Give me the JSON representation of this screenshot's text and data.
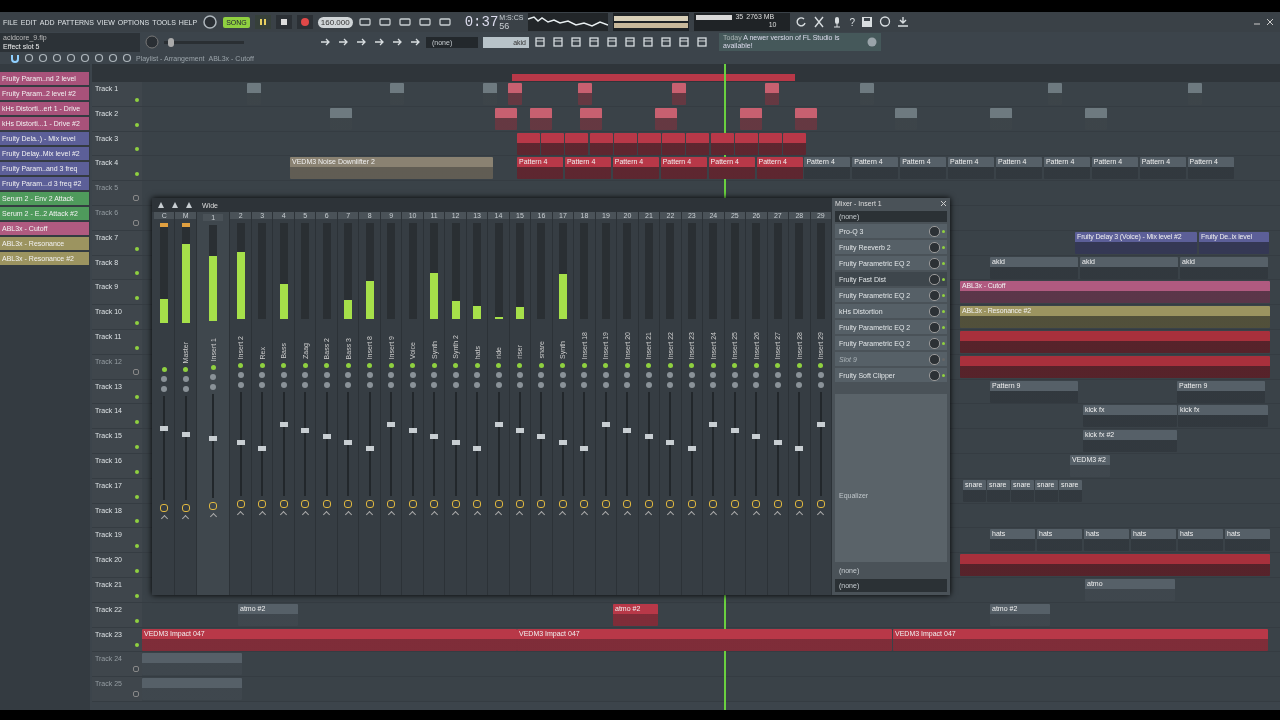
{
  "menu": [
    "FILE",
    "EDIT",
    "ADD",
    "PATTERNS",
    "VIEW",
    "OPTIONS",
    "TOOLS",
    "HELP"
  ],
  "transport": {
    "mode": "SONG",
    "song_mode": true,
    "playing": true,
    "tempo": "160.000",
    "time": "0:37",
    "time_small": "56",
    "time_unit": "M:S:CS",
    "cpu": "35",
    "memory": "2763 MB",
    "polyphony": "10",
    "help": "?"
  },
  "project": {
    "file": "acidcore_9.flp",
    "hint": "Effect slot 5"
  },
  "toolbar": {
    "pitch": {
      "level": 0.05
    },
    "pattern": "(none)",
    "channel": "akid",
    "news_day": "Today",
    "news": "A newer version of FL Studio is available!"
  },
  "breadcrumb": {
    "window": "Playlist - Arrangement",
    "target": "ABL3x - Cutoff"
  },
  "clip_list": [
    {
      "label": "Fruity Param..nd 2 level",
      "color": "#a8527a"
    },
    {
      "label": "Fruity Param..2 level #2",
      "color": "#a8527a"
    },
    {
      "label": "kHs Distorti...ert 1 - Drive",
      "color": "#a8527a"
    },
    {
      "label": "kHs Distorti...1 - Drive #2",
      "color": "#a8527a"
    },
    {
      "label": "Fruity Dela..) - Mix level",
      "color": "#5c5f98"
    },
    {
      "label": "Fruity Delay..Mix level #2",
      "color": "#5c5f98"
    },
    {
      "label": "Fruity Param..and 3 freq",
      "color": "#5c5f98"
    },
    {
      "label": "Fruity Param...d 3 freq #2",
      "color": "#5c5f98"
    },
    {
      "label": "Serum 2 - Env 2 Attack",
      "color": "#4f9a5c"
    },
    {
      "label": "Serum 2 - E..2 Attack #2",
      "color": "#4f9a5c"
    },
    {
      "label": "ABL3x - Cutoff",
      "color": "#b05a80"
    },
    {
      "label": "ABL3x - Resonance",
      "color": "#9c9460"
    },
    {
      "label": "ABL3x - Resonance #2",
      "color": "#9c9460"
    }
  ],
  "tracks": [
    {
      "name": "Track 1",
      "muted": false,
      "clips": [
        {
          "kind": "automation",
          "color": "#6e7a80"
        },
        {
          "kind": "automation",
          "color": "#6e7a80"
        },
        {
          "kind": "automation",
          "color": "#6e7a80"
        },
        {
          "kind": "automation",
          "color": "#c86070"
        },
        {
          "kind": "automation",
          "color": "#c86070"
        },
        {
          "kind": "automation",
          "color": "#c86070"
        },
        {
          "kind": "automation",
          "color": "#c86070"
        },
        {
          "kind": "automation",
          "color": "#6e7a80"
        },
        {
          "kind": "automation",
          "color": "#6e7a80"
        },
        {
          "kind": "automation",
          "color": "#6e7a80"
        }
      ]
    },
    {
      "name": "Track 2",
      "muted": false,
      "clips": [
        {
          "kind": "automation",
          "color": "#6e7a80"
        },
        {
          "kind": "automation",
          "color": "#c86070"
        },
        {
          "kind": "automation",
          "color": "#c86070"
        },
        {
          "kind": "automation",
          "color": "#c86070"
        },
        {
          "kind": "automation",
          "color": "#c86070"
        },
        {
          "kind": "automation",
          "color": "#c86070"
        },
        {
          "kind": "automation",
          "color": "#c86070"
        },
        {
          "kind": "automation",
          "color": "#6e7a80"
        },
        {
          "kind": "automation",
          "color": "#6e7a80"
        },
        {
          "kind": "automation",
          "color": "#6e7a80"
        }
      ]
    },
    {
      "name": "Track 3",
      "muted": false,
      "clips": [
        {
          "kind": "pattern",
          "color": "#b83848"
        },
        {
          "kind": "pattern",
          "color": "#b83848"
        },
        {
          "kind": "pattern",
          "color": "#b83848"
        },
        {
          "kind": "pattern",
          "color": "#b83848"
        },
        {
          "kind": "pattern",
          "color": "#b83848"
        },
        {
          "kind": "pattern",
          "color": "#b83848"
        },
        {
          "kind": "pattern",
          "color": "#b83848"
        },
        {
          "kind": "pattern",
          "color": "#b83848"
        },
        {
          "kind": "pattern",
          "color": "#b83848"
        },
        {
          "kind": "pattern",
          "color": "#b83848"
        },
        {
          "kind": "pattern",
          "color": "#b83848"
        },
        {
          "kind": "pattern",
          "color": "#b83848"
        }
      ]
    },
    {
      "name": "Track 4",
      "muted": false,
      "clips": [
        {
          "kind": "audio",
          "label": "VEDM3 Noise Downlifter 2",
          "color": "#8a8272"
        },
        {
          "kind": "pattern",
          "label": "Pattern 4",
          "color": "#b83848"
        },
        {
          "kind": "pattern",
          "label": "Pattern 4",
          "color": "#b83848"
        },
        {
          "kind": "pattern",
          "label": "Pattern 4",
          "color": "#b83848"
        },
        {
          "kind": "pattern",
          "label": "Pattern 4",
          "color": "#b83848"
        },
        {
          "kind": "pattern",
          "label": "Pattern 4",
          "color": "#b83848"
        },
        {
          "kind": "pattern",
          "label": "Pattern 4",
          "color": "#b83848"
        },
        {
          "kind": "pattern",
          "label": "Pattern 4",
          "color": "#566068"
        },
        {
          "kind": "pattern",
          "label": "Pattern 4",
          "color": "#566068"
        },
        {
          "kind": "pattern",
          "label": "Pattern 4",
          "color": "#566068"
        },
        {
          "kind": "pattern",
          "label": "Pattern 4",
          "color": "#566068"
        },
        {
          "kind": "pattern",
          "label": "Pattern 4",
          "color": "#566068"
        },
        {
          "kind": "pattern",
          "label": "Pattern 4",
          "color": "#566068"
        },
        {
          "kind": "pattern",
          "label": "Pattern 4",
          "color": "#566068"
        },
        {
          "kind": "pattern",
          "label": "Pattern 4",
          "color": "#566068"
        },
        {
          "kind": "pattern",
          "label": "Pattern 4",
          "color": "#566068"
        }
      ]
    },
    {
      "name": "Track 5",
      "muted": true
    },
    {
      "name": "Track 6",
      "muted": true
    },
    {
      "name": "Track 7",
      "muted": false,
      "clips": [
        {
          "kind": "automation",
          "label": "Fruity Delay 3 (Voice) - Mix level #2",
          "color": "#5c5f98"
        },
        {
          "kind": "automation",
          "label": "Fruity De..ix level",
          "color": "#5c5f98"
        }
      ]
    },
    {
      "name": "Track 8",
      "muted": false,
      "clips": [
        {
          "kind": "pattern",
          "label": "akid",
          "color": "#566068"
        },
        {
          "kind": "pattern",
          "label": "akid",
          "color": "#566068"
        },
        {
          "kind": "pattern",
          "label": "akid",
          "color": "#566068"
        }
      ]
    },
    {
      "name": "Track 9",
      "muted": false,
      "clips": [
        {
          "kind": "automation",
          "label": "ABL3x - Cutoff",
          "color": "#b05a80"
        }
      ]
    },
    {
      "name": "Track 10",
      "muted": false,
      "clips": [
        {
          "kind": "automation",
          "label": "ABL3x - Resonance #2",
          "color": "#9c9460"
        }
      ]
    },
    {
      "name": "Track 11",
      "muted": false,
      "clips": [
        {
          "kind": "pattern",
          "color": "#a8303c"
        }
      ]
    },
    {
      "name": "Track 12",
      "muted": true,
      "clips": [
        {
          "kind": "pattern",
          "color": "#a8303c"
        }
      ]
    },
    {
      "name": "Track 13",
      "muted": false,
      "clips": [
        {
          "kind": "pattern",
          "label": "Pattern 9",
          "color": "#566068"
        },
        {
          "kind": "pattern",
          "label": "Pattern 9",
          "color": "#566068"
        }
      ]
    },
    {
      "name": "Track 14",
      "muted": false,
      "clips": [
        {
          "kind": "pattern",
          "label": "kick fx",
          "color": "#566068"
        },
        {
          "kind": "pattern",
          "label": "kick fx",
          "color": "#566068"
        }
      ]
    },
    {
      "name": "Track 15",
      "muted": false,
      "clips": [
        {
          "kind": "pattern",
          "label": "kick fx #2",
          "color": "#566068"
        }
      ]
    },
    {
      "name": "Track 16",
      "muted": false,
      "clips": [
        {
          "kind": "audio",
          "label": "VEDM3 #2",
          "color": "#566068"
        }
      ]
    },
    {
      "name": "Track 17",
      "muted": false,
      "clips": [
        {
          "kind": "pattern",
          "label": "snare",
          "color": "#566068"
        },
        {
          "kind": "pattern",
          "label": "snare",
          "color": "#566068"
        },
        {
          "kind": "pattern",
          "label": "snare",
          "color": "#566068"
        },
        {
          "kind": "pattern",
          "label": "snare",
          "color": "#566068"
        },
        {
          "kind": "pattern",
          "label": "snare",
          "color": "#566068"
        }
      ]
    },
    {
      "name": "Track 18",
      "muted": false
    },
    {
      "name": "Track 19",
      "muted": false,
      "clips": [
        {
          "kind": "pattern",
          "label": "hats",
          "color": "#566068"
        },
        {
          "kind": "pattern",
          "label": "hats",
          "color": "#566068"
        },
        {
          "kind": "pattern",
          "label": "hats",
          "color": "#566068"
        },
        {
          "kind": "pattern",
          "label": "hats",
          "color": "#566068"
        },
        {
          "kind": "pattern",
          "label": "hats",
          "color": "#566068"
        },
        {
          "kind": "pattern",
          "label": "hats",
          "color": "#566068"
        }
      ]
    },
    {
      "name": "Track 20",
      "muted": false,
      "clips": [
        {
          "kind": "pattern",
          "color": "#a8303c"
        }
      ]
    },
    {
      "name": "Track 21",
      "muted": false,
      "clips": [
        {
          "kind": "audio",
          "label": "atmo",
          "color": "#566068"
        }
      ]
    },
    {
      "name": "Track 22",
      "muted": false,
      "clips": [
        {
          "kind": "audio",
          "label": "atmo #2",
          "color": "#566068"
        },
        {
          "kind": "audio",
          "label": "atmo #2",
          "color": "#b83848"
        },
        {
          "kind": "audio",
          "label": "atmo #2",
          "color": "#566068"
        }
      ]
    },
    {
      "name": "Track 23",
      "muted": false,
      "clips": [
        {
          "kind": "audio",
          "label": "VEDM3 Impact 047",
          "color": "#b83848"
        },
        {
          "kind": "audio",
          "label": "VEDM3 Impact 047",
          "color": "#b83848"
        },
        {
          "kind": "audio",
          "label": "VEDM3 Impact 047",
          "color": "#b83848"
        }
      ]
    },
    {
      "name": "Track 24",
      "muted": true,
      "clips": [
        {
          "kind": "audio",
          "color": "#566068"
        }
      ]
    },
    {
      "name": "Track 25",
      "muted": true,
      "clips": [
        {
          "kind": "audio",
          "color": "#566068"
        }
      ]
    }
  ],
  "mixer": {
    "view": "Wide",
    "strips": [
      {
        "number": "C",
        "level": 0.25,
        "selected": false,
        "peak": true
      },
      {
        "number": "M",
        "name": "Master",
        "level": 0.82,
        "selected": false,
        "peak": true
      },
      {
        "number": "1",
        "name": "Insert 1",
        "level": 0.68,
        "selected": true,
        "peak": false
      },
      {
        "number": "2",
        "name": "Insert 2",
        "level": 0.7,
        "selected": false,
        "peak": false
      },
      {
        "number": "3",
        "name": "Rex",
        "level": 0,
        "selected": false,
        "peak": false
      },
      {
        "number": "4",
        "name": "Bass",
        "level": 0.36,
        "selected": false,
        "peak": false
      },
      {
        "number": "5",
        "name": "Zaag",
        "level": 0,
        "selected": false,
        "peak": false
      },
      {
        "number": "6",
        "name": "Bass 2",
        "level": 0,
        "selected": false,
        "peak": false
      },
      {
        "number": "7",
        "name": "Bass 3",
        "level": 0.2,
        "selected": false,
        "peak": false
      },
      {
        "number": "8",
        "name": "Insert 8",
        "level": 0.4,
        "selected": false,
        "peak": false
      },
      {
        "number": "9",
        "name": "Insert 9",
        "level": 0,
        "selected": false,
        "peak": false
      },
      {
        "number": "10",
        "name": "Voice",
        "level": 0,
        "selected": false,
        "peak": false
      },
      {
        "number": "11",
        "name": "Synth",
        "level": 0.48,
        "selected": false,
        "peak": false
      },
      {
        "number": "12",
        "name": "Synth 2",
        "level": 0.19,
        "selected": false,
        "peak": false
      },
      {
        "number": "13",
        "name": "hats",
        "level": 0.14,
        "selected": false,
        "peak": false
      },
      {
        "number": "14",
        "name": "ride",
        "level": 0.02,
        "selected": false,
        "peak": false
      },
      {
        "number": "15",
        "name": "riser",
        "level": 0.12,
        "selected": false,
        "peak": false
      },
      {
        "number": "16",
        "name": "snare",
        "level": 0,
        "selected": false,
        "peak": false
      },
      {
        "number": "17",
        "name": "Synth",
        "level": 0.47,
        "selected": false,
        "peak": false
      },
      {
        "number": "18",
        "name": "Insert 18",
        "level": 0,
        "selected": false,
        "peak": false
      },
      {
        "number": "19",
        "name": "Insert 19",
        "level": 0,
        "selected": false,
        "peak": false
      },
      {
        "number": "20",
        "name": "Insert 20",
        "level": 0,
        "selected": false,
        "peak": false
      },
      {
        "number": "21",
        "name": "Insert 21",
        "level": 0,
        "selected": false,
        "peak": false
      },
      {
        "number": "22",
        "name": "Insert 22",
        "level": 0,
        "selected": false,
        "peak": false
      },
      {
        "number": "23",
        "name": "Insert 23",
        "level": 0,
        "selected": false,
        "peak": false
      },
      {
        "number": "24",
        "name": "Insert 24",
        "level": 0,
        "selected": false,
        "peak": false
      },
      {
        "number": "25",
        "name": "Insert 25",
        "level": 0,
        "selected": false,
        "peak": false
      },
      {
        "number": "26",
        "name": "Insert 26",
        "level": 0,
        "selected": false,
        "peak": false
      },
      {
        "number": "27",
        "name": "Insert 27",
        "level": 0,
        "selected": false,
        "peak": false
      },
      {
        "number": "28",
        "name": "Insert 28",
        "level": 0,
        "selected": false,
        "peak": false
      },
      {
        "number": "29",
        "name": "Insert 29",
        "level": 0,
        "selected": false,
        "peak": false
      }
    ]
  },
  "insert_panel": {
    "title": "Mixer - Insert 1",
    "input": "(none)",
    "slots": [
      {
        "name": "Pro-Q 3",
        "empty": false,
        "selected": false
      },
      {
        "name": "Fruity Reeverb 2",
        "empty": false,
        "selected": false
      },
      {
        "name": "Fruity Parametric EQ 2",
        "empty": false,
        "selected": false
      },
      {
        "name": "Fruity Fast Dist",
        "empty": false,
        "selected": true
      },
      {
        "name": "Fruity Parametric EQ 2",
        "empty": false,
        "selected": false
      },
      {
        "name": "kHs Distortion",
        "empty": false,
        "selected": false
      },
      {
        "name": "Fruity Parametric EQ 2",
        "empty": false,
        "selected": false
      },
      {
        "name": "Fruity Parametric EQ 2",
        "empty": false,
        "selected": false
      },
      {
        "name": "Slot 9",
        "empty": true,
        "selected": false
      },
      {
        "name": "Fruity Soft Clipper",
        "empty": false,
        "selected": false
      }
    ],
    "eq_label": "Equalizer",
    "send": "(none)",
    "output": "(none)"
  }
}
